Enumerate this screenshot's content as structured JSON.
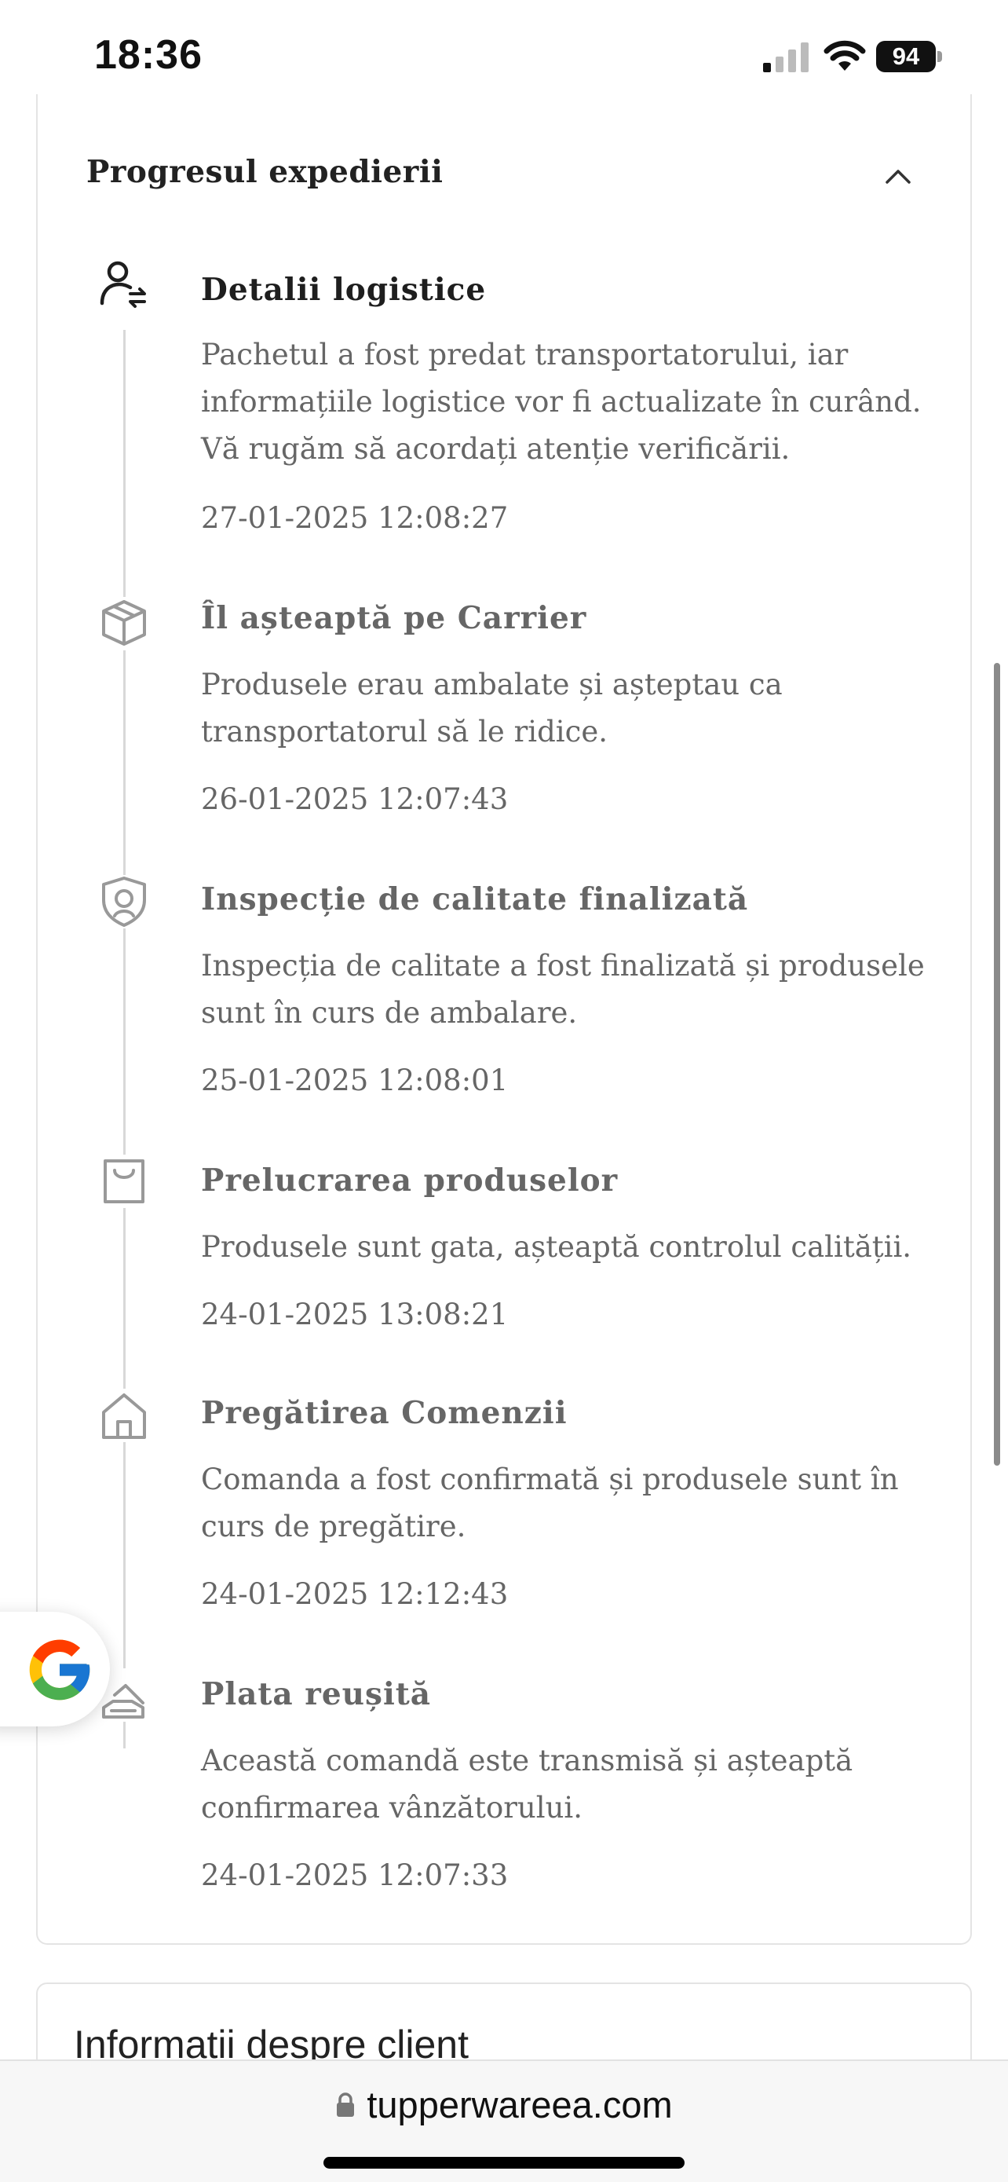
{
  "status_bar": {
    "time": "18:36",
    "battery": "94",
    "icons": [
      "signal-icon",
      "wifi-icon",
      "battery-icon"
    ]
  },
  "shipment": {
    "title": "Progresul expedierii",
    "collapse_icon": "chevron-up-icon",
    "steps": [
      {
        "icon": "user-exchange-icon",
        "title": "Detalii logistice",
        "description": "Pachetul a fost predat transportatorului, iar informațiile logistice vor fi actualizate în curând. Vă rugăm să acordați atenție verificării.",
        "timestamp": "27-01-2025 12:08:27"
      },
      {
        "icon": "package-box-icon",
        "title": "Îl așteaptă pe Carrier",
        "description": "Produsele erau ambalate și așteptau ca transportatorul să le ridice.",
        "timestamp": "26-01-2025 12:07:43"
      },
      {
        "icon": "shield-search-icon",
        "title": "Inspecție de calitate finalizată",
        "description": "Inspecția de calitate a fost finalizată și produsele sunt în curs de ambalare.",
        "timestamp": "25-01-2025 12:08:01"
      },
      {
        "icon": "shopping-bag-icon",
        "title": "Prelucrarea produselor",
        "description": "Produsele sunt gata, așteaptă controlul calității.",
        "timestamp": "24-01-2025 13:08:21"
      },
      {
        "icon": "house-icon",
        "title": "Pregătirea Comenzii",
        "description": "Comanda a fost confirmată și produsele sunt în curs de pregătire.",
        "timestamp": "24-01-2025 12:12:43"
      },
      {
        "icon": "payment-hand-icon",
        "title": "Plata reușită",
        "description": "Această comandă este transmisă și așteaptă confirmarea vânzătorului.",
        "timestamp": "24-01-2025 12:07:33"
      }
    ]
  },
  "customer_info": {
    "title": "Informatii despre client"
  },
  "google_button": {
    "icon": "google-icon"
  },
  "browser": {
    "url": "tupperwareea.com",
    "lock_icon": "lock-icon"
  },
  "colors": {
    "active_text": "#1e1e1e",
    "muted_text": "#666666",
    "timeline_line": "#d8d8d8",
    "border": "#e4e4e4"
  }
}
